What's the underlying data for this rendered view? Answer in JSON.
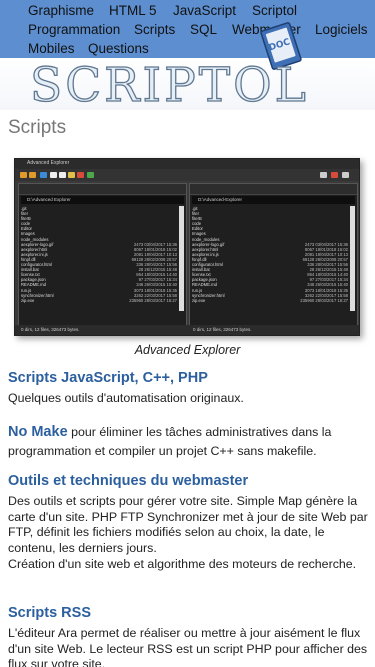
{
  "nav": {
    "row1": [
      "Graphisme",
      "HTML 5",
      "JavaScript",
      "Scriptol"
    ],
    "row2": [
      "Programmation",
      "Scripts",
      "SQL",
      "Webmaster",
      "Logiciels"
    ],
    "row3": [
      "Mobiles",
      "Questions"
    ]
  },
  "logo": {
    "text": "SCRIPTOL",
    "icon_label": "DOC"
  },
  "page": {
    "title": "Scripts"
  },
  "screenshot": {
    "window_title": "Advanced Explorer",
    "left_path": "D:\\Advanced Explorer",
    "right_path": "D:\\Advanced-Explorer",
    "files": [
      {
        "name": ".git",
        "meta": ""
      },
      {
        "name": "fiter",
        "meta": ""
      },
      {
        "name": "fiterB",
        "meta": ""
      },
      {
        "name": "code",
        "meta": ""
      },
      {
        "name": "Editor",
        "meta": ""
      },
      {
        "name": "Images",
        "meta": ""
      },
      {
        "name": "node_modules",
        "meta": ""
      },
      {
        "name": "aexplorer-logo.gif",
        "meta": "2473 03/04/2017 15:36"
      },
      {
        "name": "aexplorer.html",
        "meta": "8067 18/01/2018 15:02"
      },
      {
        "name": "aexplorer.ini.js",
        "meta": "2081 19/04/2017 10:13"
      },
      {
        "name": "fsnpf.dll",
        "meta": "69128 28/02/2008 20:57"
      },
      {
        "name": "configurator.html",
        "meta": "336 28/04/2017 15:56"
      },
      {
        "name": "install.bat",
        "meta": "28 26/12/2015 15:48"
      },
      {
        "name": "license.txt",
        "meta": "864 18/03/2015 14:40"
      },
      {
        "name": "package.json",
        "meta": "97 27/03/2017 15:34"
      },
      {
        "name": "README.md",
        "meta": "346 26/03/2015 15:40"
      },
      {
        "name": "run.js",
        "meta": "3073 18/01/2018 15:35"
      },
      {
        "name": "synchronizer.html",
        "meta": "3262 22/03/2017 15:58"
      },
      {
        "name": "zip.exe",
        "meta": "235960 28/03/2017 16:27"
      }
    ],
    "left_status": "0 dirs, 12 files, 326473 bytes.",
    "right_status": "0 dirs, 12 files, 326473 bytes."
  },
  "caption": "Advanced Explorer",
  "sections": {
    "s1_title": "Scripts JavaScript, C++, PHP",
    "s1_text": "Quelques outils d'automatisation originaux.",
    "nomake_title": "No Make",
    "nomake_text": " pour éliminer les tâches administratives dans la programmation et compiler un projet C++ sans makefile.",
    "s2_title": "Outils et techniques du webmaster",
    "s2_text1": "Des outils et scripts pour gérer votre site. Simple Map génère la carte d'un site. PHP FTP Synchronizer met à jour de site Web par FTP, définit les fichiers modifiés selon au choix, la date, le contenu, les derniers jours.",
    "s2_text2": "Création d'un site web et algorithme des moteurs de recherche.",
    "s3_title": "Scripts RSS",
    "s3_text": "L'éditeur Ara permet de réaliser ou mettre à jour aisément le flux d'un site Web. Le lecteur RSS est un script PHP pour afficher des flux sur votre site."
  }
}
